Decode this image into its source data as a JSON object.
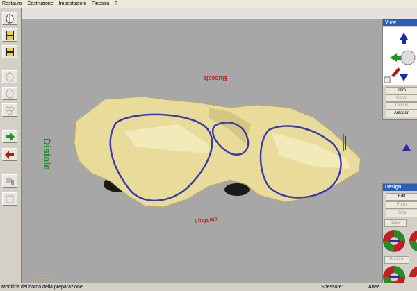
{
  "menu": {
    "items": [
      "Restauro",
      "Costruzione",
      "Impostazioni",
      "Finestra",
      "?"
    ]
  },
  "viewport": {
    "labels": {
      "distale": "Distale",
      "buccale": "Buccale",
      "linguale": "Linguale"
    }
  },
  "view_panel": {
    "title": "View",
    "trim": "Trim",
    "contorno": "Conto",
    "occlusione": "Occlus",
    "antagonist": "Antagon"
  },
  "design_panel": {
    "title": "Design",
    "edit": "Edit",
    "form": "Form",
    "drop": "Drop",
    "scale": "Scale",
    "position": "Position"
  },
  "status": {
    "message": "Modifica del bordo della preparazione",
    "spessore": "Spessore:",
    "altezza": "Altez"
  },
  "colors": {
    "tooth": "#e9dc9a",
    "margin_line": "#3a3ab0",
    "label_green": "#1f8f2a",
    "label_red": "#c02020",
    "viewport_bg": "#a7a7a7"
  }
}
